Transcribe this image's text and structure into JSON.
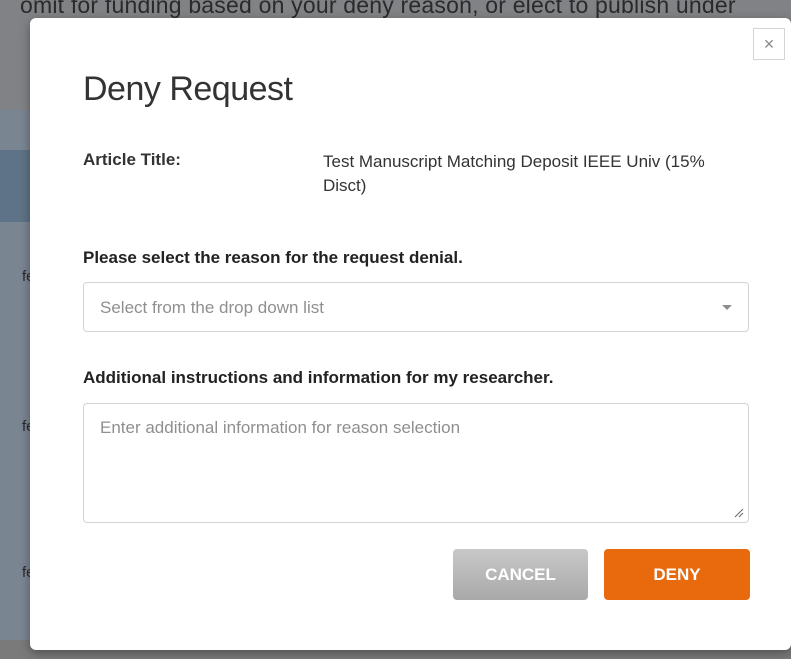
{
  "background": {
    "top_text": "omit for funding based on your deny reason, or elect to publish under",
    "row_fragment": "fe"
  },
  "modal": {
    "title": "Deny Request",
    "close_glyph": "×",
    "article": {
      "label": "Article Title:",
      "value": "Test Manuscript Matching Deposit IEEE Univ (15% Disct)"
    },
    "reason": {
      "label": "Please select the reason for the request denial.",
      "placeholder": "Select from the drop down list"
    },
    "info": {
      "label": "Additional instructions and information for my researcher.",
      "placeholder": "Enter additional information for reason selection"
    },
    "buttons": {
      "cancel": "CANCEL",
      "deny": "DENY"
    }
  },
  "colors": {
    "deny_button": "#e86a0c",
    "cancel_button": "#b5b5b5",
    "overlay": "#808285"
  },
  "icons": {
    "close": "close-icon",
    "dropdown": "chevron-down-icon",
    "resize": "resize-grip-icon"
  }
}
